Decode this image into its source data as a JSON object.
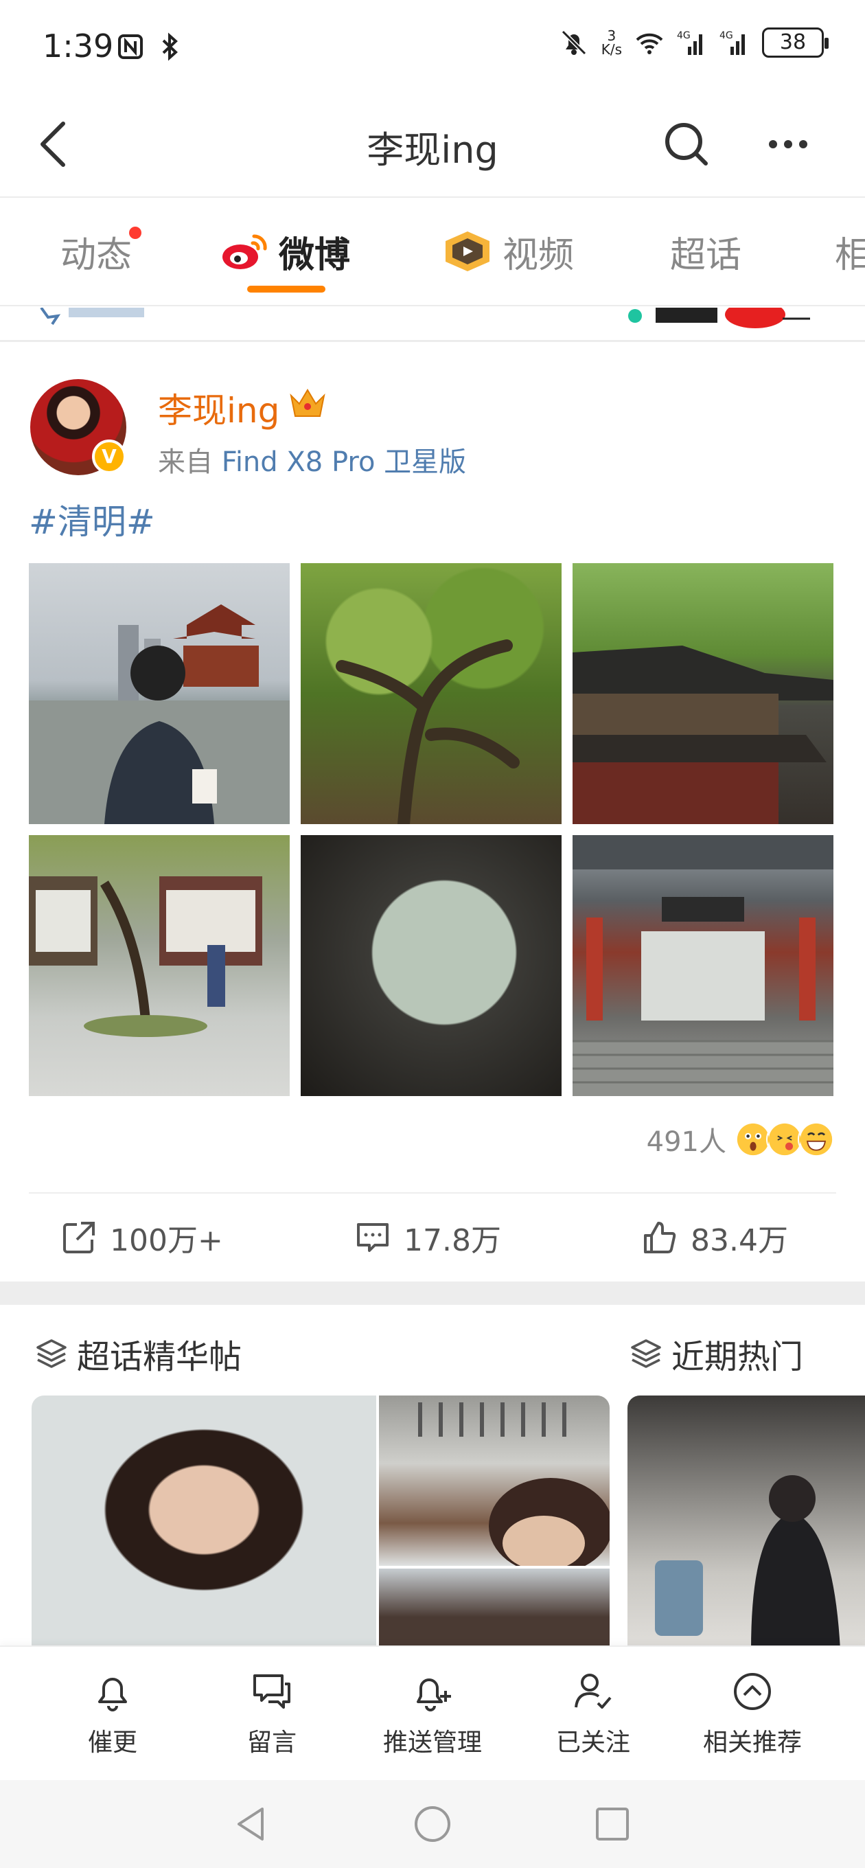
{
  "status_bar": {
    "time": "1:39",
    "net_speed_value": "3",
    "net_speed_unit": "K/s",
    "battery": "38"
  },
  "header": {
    "title": "李现ing"
  },
  "tabs": [
    {
      "label": "动态",
      "has_dot": true
    },
    {
      "label": "微博",
      "active": true
    },
    {
      "label": "视频"
    },
    {
      "label": "超话"
    },
    {
      "label": "相"
    }
  ],
  "post": {
    "author": "李现ing",
    "source_prefix": "来自",
    "source_device": "Find X8 Pro 卫星版",
    "topic": "#清明#",
    "verified_badge": "V",
    "reactions_count": "491人",
    "actions": {
      "repost": "100万+",
      "comments": "17.8万",
      "likes": "83.4万"
    }
  },
  "sections": {
    "super_topic": "超话精华帖",
    "recent_hot": "近期热门"
  },
  "toolbar": [
    {
      "label": "催更",
      "icon": "bell-icon"
    },
    {
      "label": "留言",
      "icon": "message-icon"
    },
    {
      "label": "推送管理",
      "icon": "bell-plus-icon"
    },
    {
      "label": "已关注",
      "icon": "user-check-icon"
    },
    {
      "label": "相关推荐",
      "icon": "circle-up-icon"
    }
  ],
  "colors": {
    "accent": "#ff8200",
    "author": "#e86b0d",
    "link": "#507daf"
  }
}
